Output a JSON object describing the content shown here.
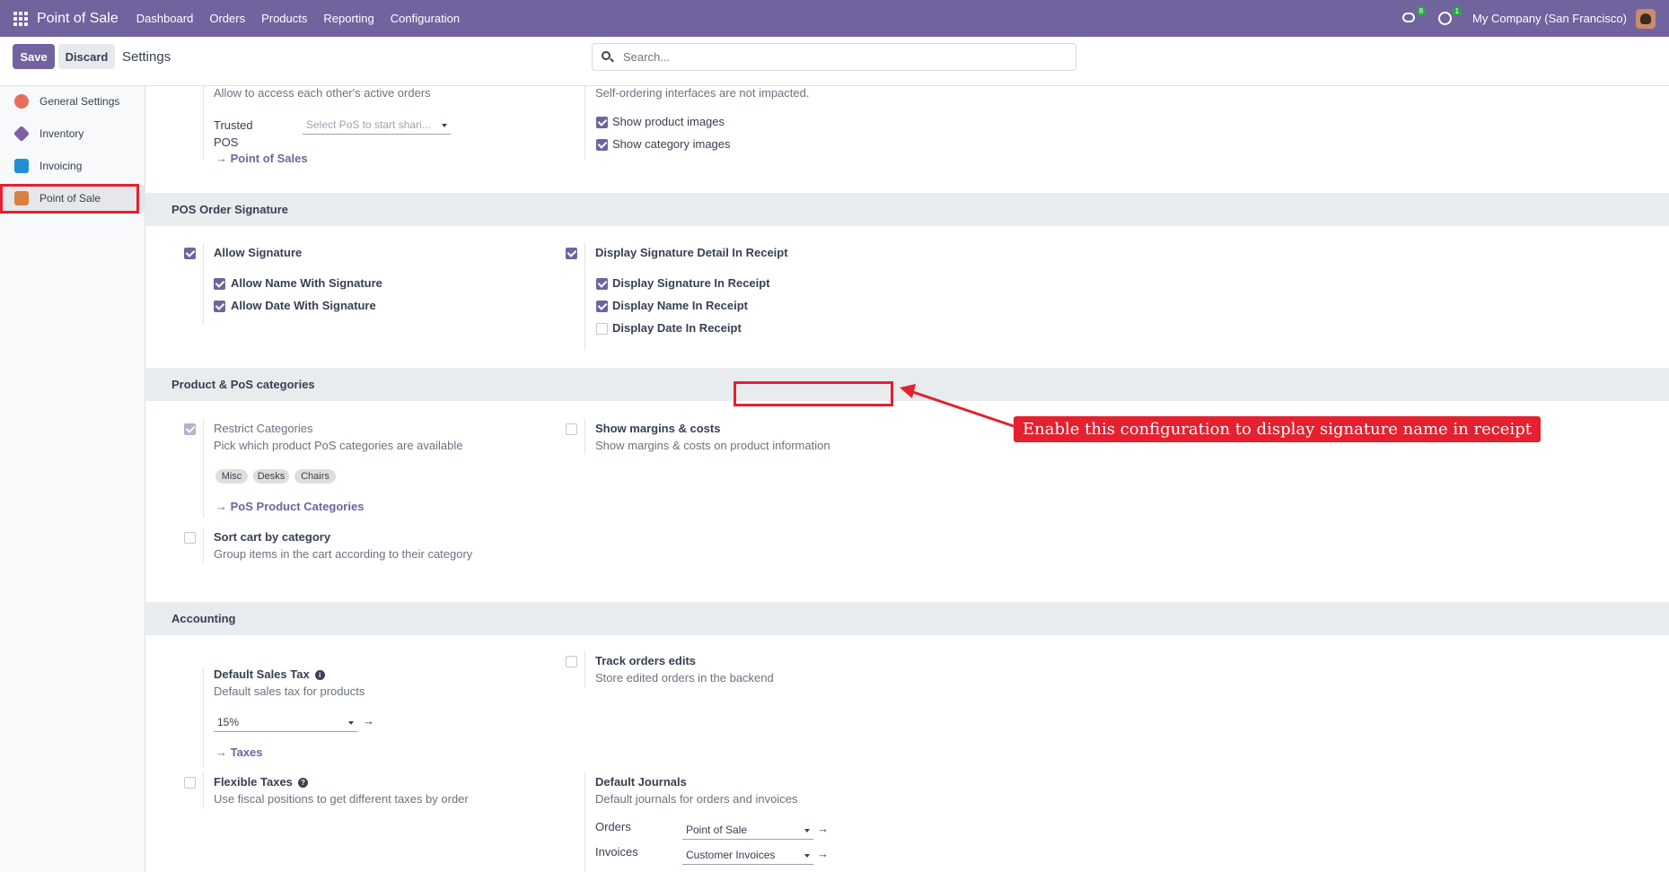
{
  "navbar": {
    "app_name": "Point of Sale",
    "menu": [
      "Dashboard",
      "Orders",
      "Products",
      "Reporting",
      "Configuration"
    ],
    "messages_badge": "8",
    "activities_badge": "1",
    "company": "My Company (San Francisco)"
  },
  "control_panel": {
    "save": "Save",
    "discard": "Discard",
    "title": "Settings",
    "search_placeholder": "Search..."
  },
  "sidebar": {
    "items": [
      {
        "label": "General Settings",
        "color": "#e46f5b"
      },
      {
        "label": "Inventory",
        "color": "#7b5ea7"
      },
      {
        "label": "Invoicing",
        "color": "#1f8fd6"
      },
      {
        "label": "Point of Sale",
        "color": "#d9813e"
      }
    ]
  },
  "top_partial": {
    "shared_desc": "Allow to access each other's active orders",
    "trusted_label": "Trusted POS",
    "trusted_placeholder": "Select PoS to start shari...",
    "pos_link": "Point of Sales",
    "self_order_note": "Self-ordering interfaces are not impacted.",
    "show_product_images": "Show product images",
    "show_category_images": "Show category images"
  },
  "signature": {
    "header": "POS Order Signature",
    "allow_signature": "Allow Signature",
    "allow_name": "Allow Name With Signature",
    "allow_date": "Allow Date With Signature",
    "display_detail": "Display Signature Detail In Receipt",
    "display_sig": "Display Signature In Receipt",
    "display_name": "Display Name In Receipt",
    "display_date": "Display Date In Receipt"
  },
  "annotation": "Enable this configuration to display signature name in receipt",
  "categories": {
    "header": "Product & PoS categories",
    "restrict": "Restrict Categories",
    "restrict_desc": "Pick which product PoS categories are available",
    "tags": [
      "Misc",
      "Desks",
      "Chairs"
    ],
    "categories_link": "PoS Product Categories",
    "margins": "Show margins & costs",
    "margins_desc": "Show margins & costs on product information",
    "sort_cart": "Sort cart by category",
    "sort_cart_desc": "Group items in the cart according to their category"
  },
  "accounting": {
    "header": "Accounting",
    "default_tax": "Default Sales Tax",
    "default_tax_desc": "Default sales tax for products",
    "tax_value": "15%",
    "taxes_link": "Taxes",
    "track_edits": "Track orders edits",
    "track_edits_desc": "Store edited orders in the backend",
    "flexible_taxes": "Flexible Taxes",
    "flexible_desc": "Use fiscal positions to get different taxes by order",
    "default_journals": "Default Journals",
    "journals_desc": "Default journals for orders and invoices",
    "orders_label": "Orders",
    "orders_value": "Point of Sale",
    "invoices_label": "Invoices",
    "invoices_value": "Customer Invoices"
  }
}
